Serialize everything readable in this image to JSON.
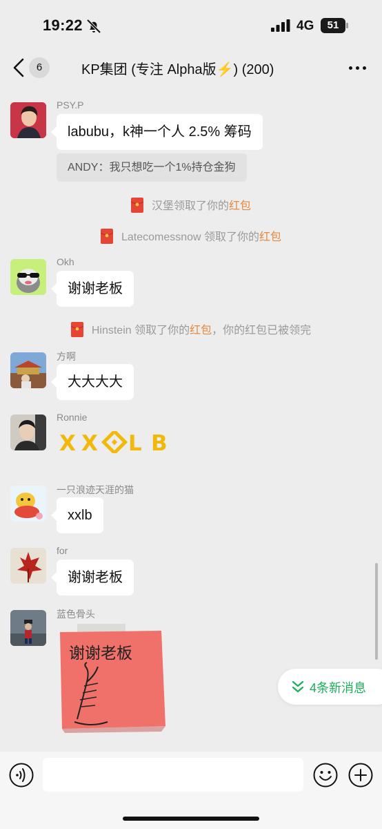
{
  "status_bar": {
    "time": "19:22",
    "network": "4G",
    "battery": "51"
  },
  "header": {
    "unread_count": "6",
    "title": "KP集团 (专注 Alpha版⚡️) (200)"
  },
  "messages": [
    {
      "sender": "PSY.P",
      "text": "labubu，k神一个人 2.5% 筹码",
      "quote": "ANDY：我只想吃一个1%持仓金狗"
    },
    {
      "sender": "Okh",
      "text": "谢谢老板"
    },
    {
      "sender": "方啊",
      "text": "大大大大"
    },
    {
      "sender": "Ronnie",
      "sticker_text": "XXLB"
    },
    {
      "sender": "一只浪迹天涯的猫",
      "text": "xxlb"
    },
    {
      "sender": "for",
      "text": "谢谢老板"
    },
    {
      "sender": "蓝色骨头",
      "sticker_text": "谢谢老板"
    }
  ],
  "system_messages": [
    {
      "before": "汉堡领取了你的",
      "highlight": "红包",
      "after": ""
    },
    {
      "before": "Latecomessnow 领取了你的",
      "highlight": "红包",
      "after": ""
    },
    {
      "before": "Hinstein 领取了你的",
      "highlight": "红包",
      "after": "，你的红包已被领完"
    }
  ],
  "new_messages": {
    "label": "4条新消息"
  },
  "input": {
    "value": "",
    "placeholder": ""
  },
  "colors": {
    "accent_green": "#1aad5a",
    "highlight_orange": "#e8883c",
    "envelope_red": "#e54535",
    "binance_yellow": "#f0b90b"
  },
  "icons": [
    "bell-off-icon",
    "signal-icon",
    "battery-icon",
    "back-icon",
    "more-icon",
    "red-envelope-icon",
    "double-chevron-down-icon",
    "voice-icon",
    "emoji-icon",
    "plus-icon"
  ]
}
